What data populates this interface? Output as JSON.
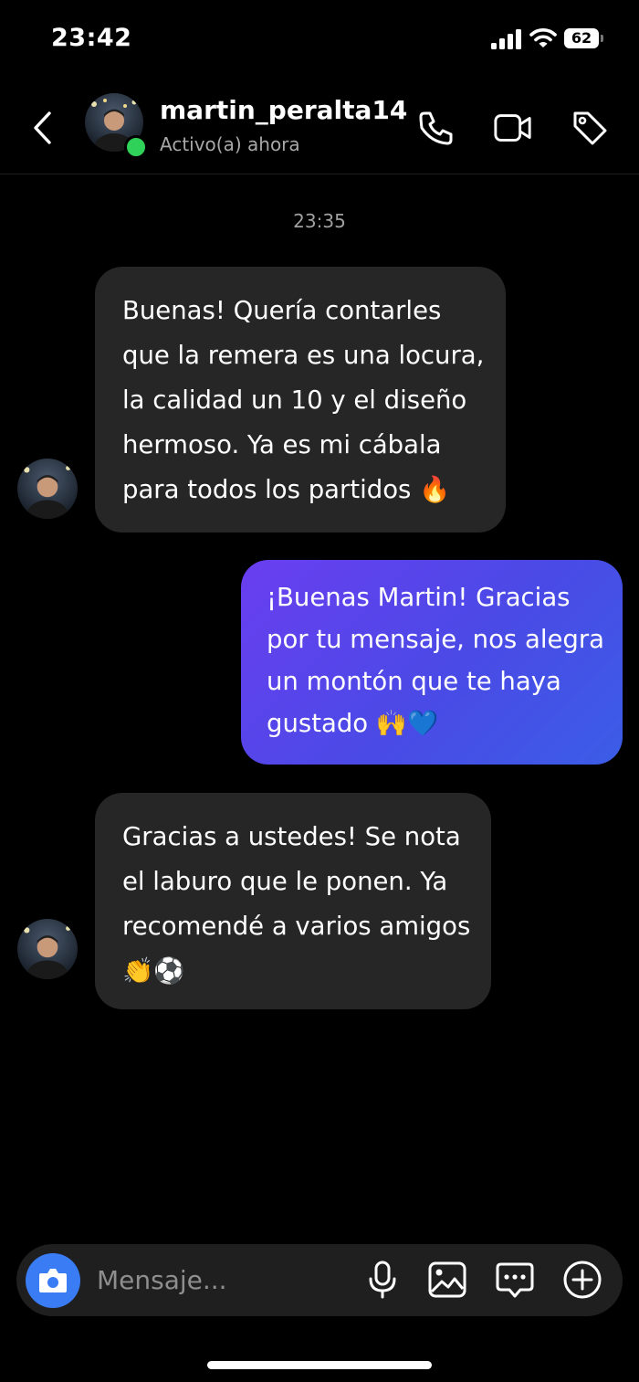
{
  "status_bar": {
    "time": "23:42",
    "battery": "62"
  },
  "header": {
    "username": "martin_peralta14",
    "active_status": "Activo(a) ahora",
    "icons": [
      "back-arrow-icon",
      "phone-icon",
      "video-camera-icon",
      "tag-icon"
    ]
  },
  "conversation": {
    "timestamp": "23:35",
    "messages": [
      {
        "direction": "incoming",
        "text": "Buenas! Quería contarles\nque la remera es una locura,\nla calidad un 10 y el diseño\nhermoso. Ya es mi cábala\npara todos los partidos 🔥"
      },
      {
        "direction": "outgoing",
        "text": "¡Buenas Martin! Gracias\npor tu mensaje, nos alegra\nun montón que te haya\ngustado 🙌💙"
      },
      {
        "direction": "incoming",
        "text": "Gracias a ustedes! Se nota\nel laburo que le ponen. Ya\nrecomendé a varios amigos\n👏⚽"
      }
    ]
  },
  "composer": {
    "placeholder": "Mensaje...",
    "icons": [
      "camera-icon",
      "microphone-icon",
      "gallery-icon",
      "chat-options-icon",
      "plus-icon"
    ]
  },
  "colors": {
    "background": "#000000",
    "incoming_bubble": "#262626",
    "outgoing_bubble_start": "#6a3ef0",
    "outgoing_bubble_end": "#3b5de7",
    "online_dot": "#2fd158",
    "camera_button": "#3a7cf4"
  }
}
